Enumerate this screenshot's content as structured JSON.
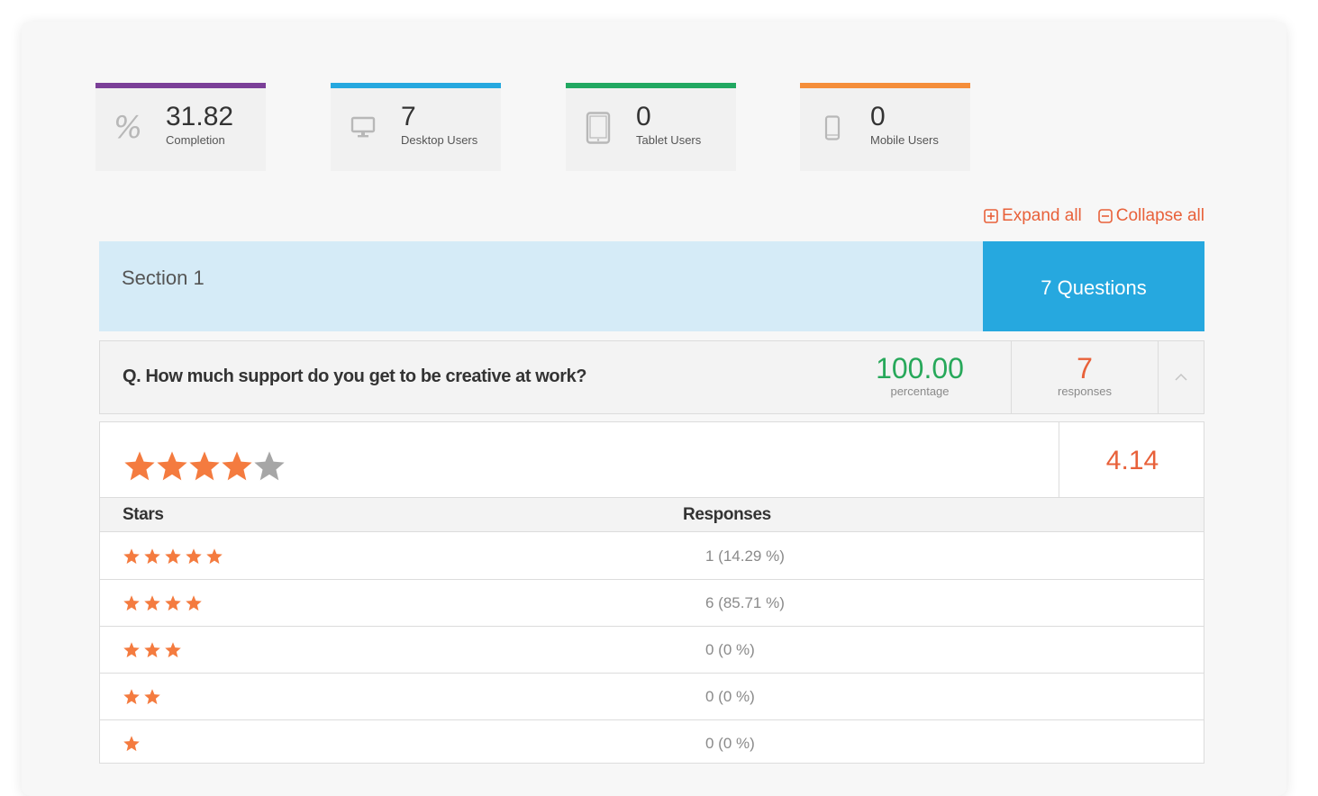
{
  "stats": [
    {
      "value": "31.82",
      "label": "Completion",
      "color": "#7b3f98",
      "icon": "percent-icon"
    },
    {
      "value": "7",
      "label": "Desktop Users",
      "color": "#26a8df",
      "icon": "desktop-icon"
    },
    {
      "value": "0",
      "label": "Tablet Users",
      "color": "#21a861",
      "icon": "tablet-icon"
    },
    {
      "value": "0",
      "label": "Mobile Users",
      "color": "#f58e3a",
      "icon": "mobile-icon"
    }
  ],
  "toolbar": {
    "expand_label": "Expand all",
    "collapse_label": "Collapse all"
  },
  "section": {
    "title": "Section 1",
    "questions_label": "7 Questions"
  },
  "question": {
    "text": "Q. How much support do you get to be creative at work?",
    "percentage": "100.00",
    "percentage_label": "percentage",
    "responses": "7",
    "responses_label": "responses"
  },
  "rating": {
    "average": "4.14",
    "average_stars": 4.14,
    "columns": [
      "Stars",
      "Responses"
    ],
    "rows": [
      {
        "stars": 5,
        "responses": "1 (14.29 %)"
      },
      {
        "stars": 4,
        "responses": "6 (85.71 %)"
      },
      {
        "stars": 3,
        "responses": "0 (0 %)"
      },
      {
        "stars": 2,
        "responses": "0 (0 %)"
      },
      {
        "stars": 1,
        "responses": "0 (0 %)"
      }
    ]
  },
  "colors": {
    "accent": "#e8613a",
    "star": "#f47b3f",
    "star_empty": "#a6a6a6",
    "section_bg": "#d5ebf7",
    "section_accent": "#26a8df"
  }
}
